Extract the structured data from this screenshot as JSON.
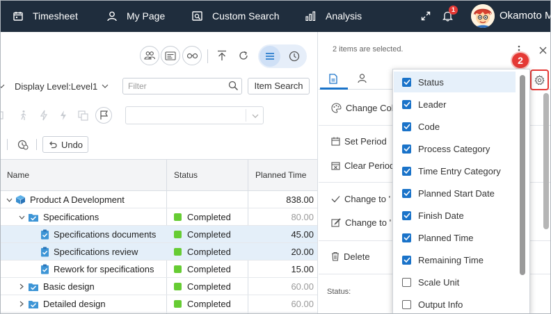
{
  "topnav": {
    "items": [
      {
        "label": "Timesheet",
        "icon": "calendar-icon"
      },
      {
        "label": "My Page",
        "icon": "user-icon"
      },
      {
        "label": "Custom Search",
        "icon": "search-window-icon"
      },
      {
        "label": "Analysis",
        "icon": "bar-chart-icon"
      }
    ],
    "notification_count": "1",
    "user_name": "Okamoto M"
  },
  "toolbar": {
    "display_level": "Display Level:Level1",
    "filter_placeholder": "Filter",
    "item_search_label": "Item Search",
    "undo_label": "Undo"
  },
  "table": {
    "headers": {
      "name": "Name",
      "status": "Status",
      "planned_time": "Planned Time"
    },
    "rows": [
      {
        "name": "Product A Development",
        "status": "",
        "time": "838.00",
        "level": 0,
        "type": "project",
        "selected": false,
        "expand": "down"
      },
      {
        "name": "Specifications",
        "status": "Completed",
        "time": "80.00",
        "level": 1,
        "type": "folder",
        "selected": false,
        "expand": "down"
      },
      {
        "name": "Specifications documents",
        "status": "Completed",
        "time": "45.00",
        "level": 2,
        "type": "task",
        "selected": true,
        "expand": ""
      },
      {
        "name": "Specifications review",
        "status": "Completed",
        "time": "20.00",
        "level": 2,
        "type": "task",
        "selected": true,
        "expand": ""
      },
      {
        "name": "Rework for specifications",
        "status": "Completed",
        "time": "15.00",
        "level": 2,
        "type": "task",
        "selected": false,
        "expand": ""
      },
      {
        "name": "Basic design",
        "status": "Completed",
        "time": "60.00",
        "level": 1,
        "type": "folder",
        "selected": false,
        "expand": "right"
      },
      {
        "name": "Detailed design",
        "status": "Completed",
        "time": "60.00",
        "level": 1,
        "type": "folder",
        "selected": false,
        "expand": "right"
      }
    ]
  },
  "side_panel": {
    "selection_text": "2 items are selected.",
    "actions": {
      "change_color": "Change Col",
      "set_period": "Set Period",
      "clear_period": "Clear Period",
      "change_to_1": "Change to '",
      "change_to_2": "Change to '",
      "delete": "Delete"
    },
    "status_label": "Status:"
  },
  "column_menu": {
    "items": [
      {
        "label": "Status",
        "checked": true
      },
      {
        "label": "Leader",
        "checked": true
      },
      {
        "label": "Code",
        "checked": true
      },
      {
        "label": "Process Category",
        "checked": true
      },
      {
        "label": "Time Entry Category",
        "checked": true
      },
      {
        "label": "Planned Start Date",
        "checked": true
      },
      {
        "label": "Finish Date",
        "checked": true
      },
      {
        "label": "Planned Time",
        "checked": true
      },
      {
        "label": "Remaining Time",
        "checked": true
      },
      {
        "label": "Scale Unit",
        "checked": false
      },
      {
        "label": "Output Info",
        "checked": false
      }
    ]
  },
  "callout_number": "2",
  "colors": {
    "nav_bg": "#1f2d3d",
    "accent": "#1a73c9",
    "status_completed": "#66cc33",
    "callout": "#e53935",
    "selected_row": "#e4eff9"
  }
}
